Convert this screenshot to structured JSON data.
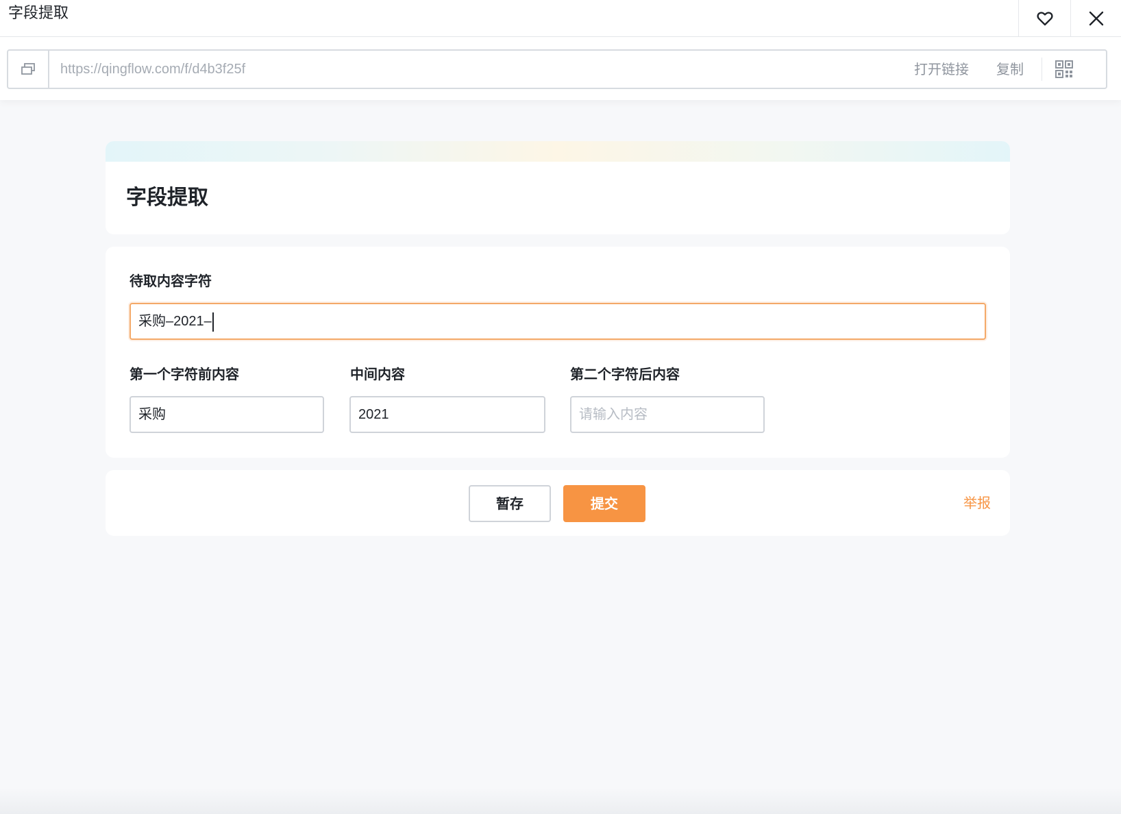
{
  "window": {
    "title": "字段提取",
    "favorite_icon": "heart-icon",
    "close_icon": "close-icon"
  },
  "url_bar": {
    "url": "https://qingflow.com/f/d4b3f25f",
    "open_link_label": "打开链接",
    "copy_label": "复制",
    "qr_icon": "qr-code-icon",
    "copy_icon": "copy-window-icon"
  },
  "form": {
    "title": "字段提取",
    "fields": {
      "source": {
        "label": "待取内容字符",
        "value": "采购–2021–"
      },
      "before_first": {
        "label": "第一个字符前内容",
        "value": "采购"
      },
      "middle": {
        "label": "中间内容",
        "value": "2021"
      },
      "after_second": {
        "label": "第二个字符后内容",
        "value": "",
        "placeholder": "请输入内容"
      }
    }
  },
  "actions": {
    "save_label": "暂存",
    "submit_label": "提交",
    "report_label": "举报"
  },
  "colors": {
    "accent": "#f79443",
    "focus_border": "#f4a968",
    "page_bg": "#f7f8fa"
  }
}
